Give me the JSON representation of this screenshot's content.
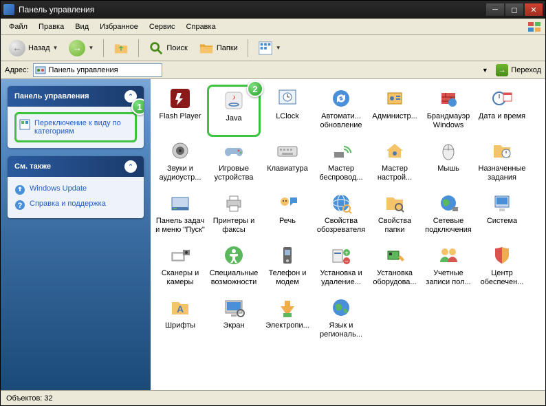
{
  "title": "Панель управления",
  "menus": [
    "Файл",
    "Правка",
    "Вид",
    "Избранное",
    "Сервис",
    "Справка"
  ],
  "toolbar": {
    "back": "Назад",
    "search": "Поиск",
    "folders": "Папки"
  },
  "address": {
    "label": "Адрес:",
    "value": "Панель управления",
    "go": "Переход"
  },
  "sidebar": {
    "panel1": {
      "title": "Панель управления",
      "link": "Переключение к виду по категориям"
    },
    "panel2": {
      "title": "См. также",
      "links": [
        "Windows Update",
        "Справка и поддержка"
      ]
    }
  },
  "callouts": {
    "one": "1",
    "two": "2"
  },
  "items": [
    {
      "label": "Flash Player",
      "glyph": "flash"
    },
    {
      "label": "Java",
      "glyph": "java",
      "hl": true
    },
    {
      "label": "LClock",
      "glyph": "clock"
    },
    {
      "label": "Автомати... обновление",
      "glyph": "autoupdate"
    },
    {
      "label": "Администр...",
      "glyph": "admin"
    },
    {
      "label": "Брандмауэр Windows",
      "glyph": "firewall"
    },
    {
      "label": "Дата и время",
      "glyph": "datetime"
    },
    {
      "label": "Звуки и аудиоустр...",
      "glyph": "sound"
    },
    {
      "label": "Игровые устройства",
      "glyph": "gamepad"
    },
    {
      "label": "Клавиатура",
      "glyph": "keyboard"
    },
    {
      "label": "Мастер беспровод...",
      "glyph": "wireless"
    },
    {
      "label": "Мастер настрой...",
      "glyph": "nethome"
    },
    {
      "label": "Мышь",
      "glyph": "mouse"
    },
    {
      "label": "Назначенные задания",
      "glyph": "tasks"
    },
    {
      "label": "Панель задач и меню \"Пуск\"",
      "glyph": "taskbar"
    },
    {
      "label": "Принтеры и факсы",
      "glyph": "printer"
    },
    {
      "label": "Речь",
      "glyph": "speech"
    },
    {
      "label": "Свойства обозревателя",
      "glyph": "inet"
    },
    {
      "label": "Свойства папки",
      "glyph": "folderopt"
    },
    {
      "label": "Сетевые подключения",
      "glyph": "netconn"
    },
    {
      "label": "Система",
      "glyph": "system"
    },
    {
      "label": "Сканеры и камеры",
      "glyph": "scanner"
    },
    {
      "label": "Специальные возможности",
      "glyph": "access"
    },
    {
      "label": "Телефон и модем",
      "glyph": "phone"
    },
    {
      "label": "Установка и удаление...",
      "glyph": "addremove"
    },
    {
      "label": "Установка оборудова...",
      "glyph": "hardware"
    },
    {
      "label": "Учетные записи пол...",
      "glyph": "users"
    },
    {
      "label": "Центр обеспечен...",
      "glyph": "security"
    },
    {
      "label": "Шрифты",
      "glyph": "fonts"
    },
    {
      "label": "Экран",
      "glyph": "display"
    },
    {
      "label": "Электропи...",
      "glyph": "power"
    },
    {
      "label": "Язык и региональ...",
      "glyph": "region"
    }
  ],
  "status": "Объектов: 32"
}
